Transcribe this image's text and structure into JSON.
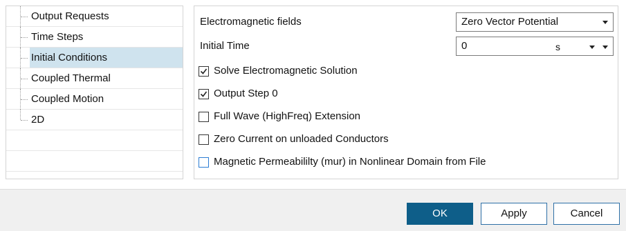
{
  "tree": {
    "items": [
      {
        "label": "Output Requests"
      },
      {
        "label": "Time Steps"
      },
      {
        "label": "Initial Conditions",
        "selected": true
      },
      {
        "label": "Coupled Thermal"
      },
      {
        "label": "Coupled Motion"
      },
      {
        "label": "2D"
      }
    ]
  },
  "form": {
    "em_fields": {
      "label": "Electromagnetic fields",
      "value": "Zero Vector Potential"
    },
    "initial_time": {
      "label": "Initial Time",
      "value": "0",
      "unit": "s"
    },
    "checks": [
      {
        "label": "Solve Electromagnetic Solution",
        "checked": true
      },
      {
        "label": "Output Step 0",
        "checked": true
      },
      {
        "label": "Full Wave (HighFreq) Extension",
        "checked": false
      },
      {
        "label": "Zero Current on unloaded Conductors",
        "checked": false
      },
      {
        "label": "Magnetic Permeabililty (mur) in Nonlinear Domain from File",
        "checked": false
      }
    ]
  },
  "buttons": {
    "ok": "OK",
    "apply": "Apply",
    "cancel": "Cancel"
  },
  "colors": {
    "selection": "#cfe3ee",
    "ok_button": "#0e5e89",
    "button_border": "#2d6fa6",
    "focus_checkbox": "#2b7cd3"
  },
  "icons": {
    "checked": "checkmark-icon",
    "dropdown": "chevron-down-icon"
  }
}
